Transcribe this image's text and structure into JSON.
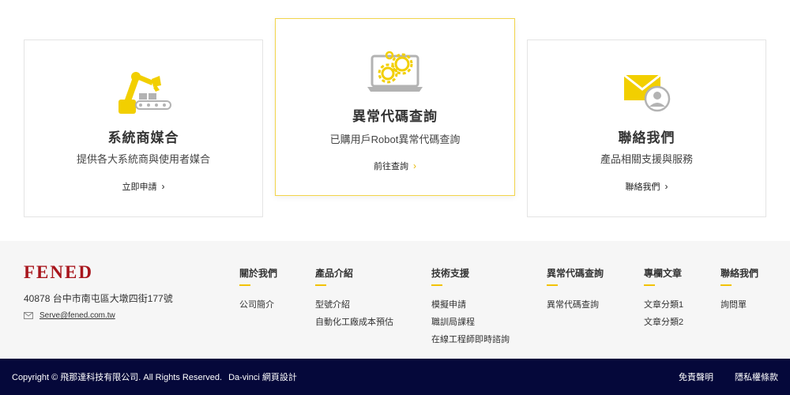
{
  "cards": [
    {
      "title": "系統商媒合",
      "desc": "提供各大系統商與使用者媒合",
      "link": "立即申請",
      "icon": "robot-arm-icon"
    },
    {
      "title": "異常代碼查詢",
      "desc": "已購用戶Robot異常代碼查詢",
      "link": "前往查詢",
      "icon": "laptop-gears-icon"
    },
    {
      "title": "聯絡我們",
      "desc": "產品相關支援與服務",
      "link": "聯絡我們",
      "icon": "envelope-person-icon"
    }
  ],
  "footer": {
    "logo": "FENED",
    "address": "40878 台中市南屯區大墩四街177號",
    "email": "Serve@fened.com.tw",
    "columns": [
      {
        "heading": "關於我們",
        "links": [
          "公司簡介"
        ]
      },
      {
        "heading": "產品介紹",
        "links": [
          "型號介紹",
          "自動化工廠成本預估"
        ]
      },
      {
        "heading": "技術支援",
        "links": [
          "模擬申請",
          "職訓局課程",
          "在線工程師即時諮詢"
        ]
      },
      {
        "heading": "異常代碼查詢",
        "links": [
          "異常代碼查詢"
        ]
      },
      {
        "heading": "專欄文章",
        "links": [
          "文章分類1",
          "文章分類2"
        ]
      },
      {
        "heading": "聯絡我們",
        "links": [
          "詢問單"
        ]
      }
    ]
  },
  "bottom": {
    "copyright": "Copyright © 飛那達科技有限公司. All Rights Reserved.",
    "designer": "Da-vinci 網頁設計",
    "links": [
      "免責聲明",
      "隱私權條款"
    ]
  },
  "colors": {
    "accent": "#f2c200",
    "brand": "#a8161d",
    "bottom_bar": "#05083a",
    "icon_gray": "#b3b3b3",
    "icon_yellow": "#f2cf00"
  }
}
